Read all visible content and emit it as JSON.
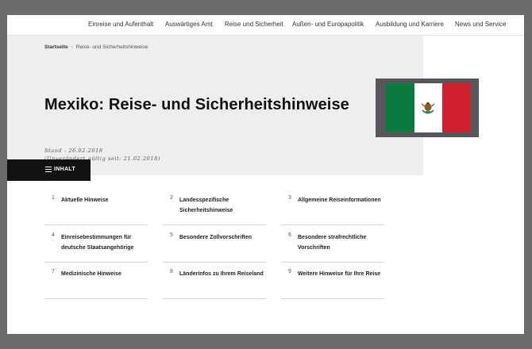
{
  "nav": {
    "items": [
      "Einreise und Aufenthalt",
      "Auswärtiges Amt",
      "Reise und Sicherheit",
      "Außen- und Europapolitik",
      "Ausbildung und Karriere",
      "News und Service"
    ]
  },
  "breadcrumb": {
    "home": "Startseite",
    "separator": "›",
    "current": "Reise- und Sicherheitshinweise"
  },
  "page": {
    "title": "Mexiko: Reise- und Sicherheitshinweise",
    "stand": "Stand - 26.02.2018",
    "unchanged": "(Unverändert gültig seit: 21.02.2018)"
  },
  "flag": {
    "country": "Mexiko",
    "colors": [
      "#0b7a3e",
      "#ffffff",
      "#d21f2e"
    ]
  },
  "inhalt": {
    "label": "INHALT",
    "icon": "list-icon"
  },
  "toc": {
    "items": [
      {
        "num": "1",
        "label": "Aktuelle Hinweise"
      },
      {
        "num": "2",
        "label": "Landesspezifische Sicherheitshinweise"
      },
      {
        "num": "3",
        "label": "Allgemeine Reiseinformationen"
      },
      {
        "num": "4",
        "label": "Einreisebestimmungen für deutsche Staatsangehörige"
      },
      {
        "num": "5",
        "label": "Besondere Zollvorschriften"
      },
      {
        "num": "6",
        "label": "Besondere strafrechtliche Vorschriften"
      },
      {
        "num": "7",
        "label": "Medizinische Hinweise"
      },
      {
        "num": "8",
        "label": "Länderinfos zu Ihrem Reiseland"
      },
      {
        "num": "9",
        "label": "Weitere Hinweise für Ihre Reise"
      }
    ]
  }
}
